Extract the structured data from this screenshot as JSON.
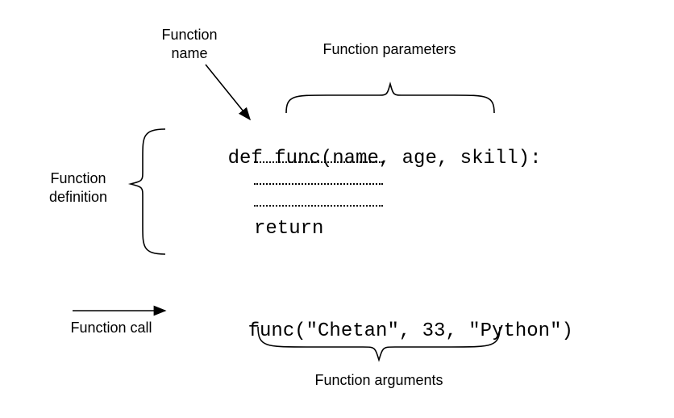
{
  "labels": {
    "function_name": "Function\nname",
    "function_parameters": "Function parameters",
    "function_definition": "Function\ndefinition",
    "function_call": "Function call",
    "function_arguments": "Function arguments"
  },
  "code": {
    "def_keyword": "def ",
    "func_name": "func",
    "paren_open": "(",
    "params": "name, age, skill",
    "paren_close_colon": "):",
    "return_keyword": "return",
    "call_name": "func",
    "call_open": "(",
    "call_args": "\"Chetan\", 33, \"Python\"",
    "call_close": ")"
  }
}
